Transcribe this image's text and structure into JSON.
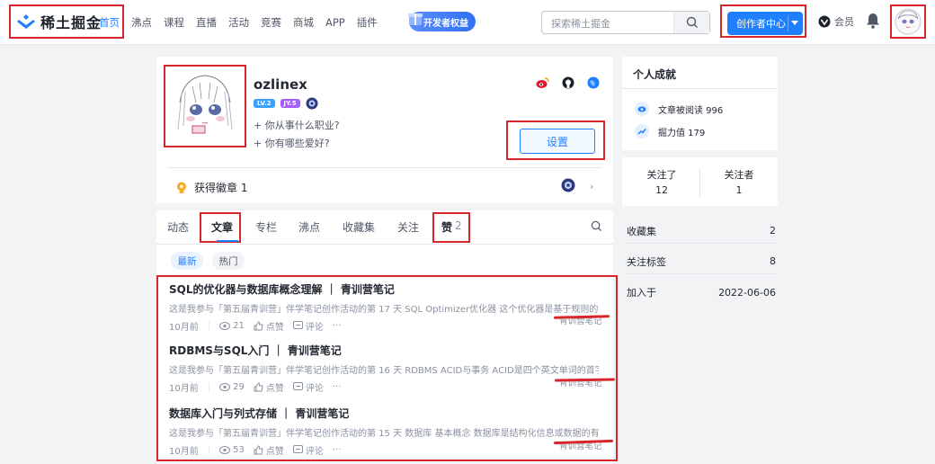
{
  "header": {
    "logo_text": "稀土掘金",
    "nav": [
      "首页",
      "沸点",
      "课程",
      "直播",
      "活动",
      "竞赛",
      "商城",
      "APP",
      "插件"
    ],
    "dev_badge": "开发者权益",
    "search_placeholder": "探索稀土掘金",
    "creator_label": "创作者中心",
    "vip_label": "会员"
  },
  "profile": {
    "username": "ozlinex",
    "level_badges": [
      "LV.2",
      "JY.5"
    ],
    "job_prompt": "+ 你从事什么职业?",
    "hobby_prompt": "+ 你有哪些爱好?",
    "settings_label": "设置",
    "badges_label": "获得徽章 1"
  },
  "tabs": {
    "items": [
      "动态",
      "文章",
      "专栏",
      "沸点",
      "收藏集",
      "关注",
      "赞"
    ],
    "like_count": "2",
    "filters": [
      "最新",
      "热门"
    ]
  },
  "articles": [
    {
      "title": "SQL的优化器与数据库概念理解 ｜ 青训营笔记",
      "desc": "这是我参与「第五届青训营」伴学笔记创作活动的第 17 天 SQL Optimizer优化器 这个优化器是基于规则的优化...",
      "time": "10月前",
      "views": "21",
      "like": "点赞",
      "comment": "评论",
      "more": "···",
      "tag": "青训营笔记"
    },
    {
      "title": "RDBMS与SQL入门 ｜ 青训营笔记",
      "desc": "这是我参与「第五届青训营」伴学笔记创作活动的第 16 天 RDBMS ACID与事务 ACID是四个英文单词的首字母，...",
      "time": "10月前",
      "views": "29",
      "like": "点赞",
      "comment": "评论",
      "more": "···",
      "tag": "青训营笔记"
    },
    {
      "title": "数据库入门与列式存储 ｜ 青训营笔记",
      "desc": "这是我参与「第五届青训营」伴学笔记创作活动的第 15 天 数据库 基本概念 数据库是结构化信息或数据的有序集...",
      "time": "10月前",
      "views": "53",
      "like": "点赞",
      "comment": "评论",
      "more": "···",
      "tag": "青训营笔记"
    }
  ],
  "achievements": {
    "title": "个人成就",
    "reads": "文章被阅读 996",
    "power": "掘力值 179"
  },
  "follow": {
    "following_label": "关注了",
    "following_count": "12",
    "followers_label": "关注者",
    "followers_count": "1"
  },
  "stats": [
    {
      "label": "收藏集",
      "value": "2"
    },
    {
      "label": "关注标签",
      "value": "8"
    },
    {
      "label": "加入于",
      "value": "2022-06-06"
    }
  ],
  "colors": {
    "accent": "#1e80ff",
    "annotation_red": "#d8262d"
  }
}
